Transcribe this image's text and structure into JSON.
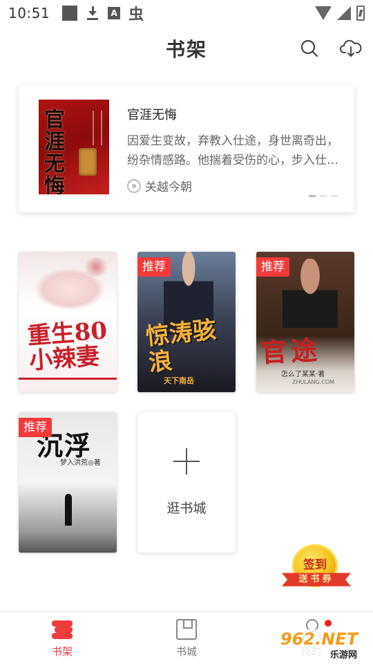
{
  "status_bar": {
    "time": "10:51",
    "icons_left": [
      "square-icon",
      "download-icon",
      "a-icon",
      "bug-icon"
    ],
    "icons_right": [
      "wifi-icon",
      "signal-icon",
      "battery-icon"
    ]
  },
  "header": {
    "title": "书架",
    "icons": [
      "search-icon",
      "cloud-download-icon"
    ]
  },
  "featured": {
    "title": "官涯无悔",
    "description": "因爱生变故，弃教入仕途，身世离奇出，纷杂情感路。他揣着受伤的心，步入仕…",
    "author": "关越今朝",
    "cover_text": "官涯无悔",
    "carousel": {
      "count": 3,
      "active_index": 0
    }
  },
  "books": [
    {
      "cover_text": "重生80小辣妻",
      "badge": ""
    },
    {
      "cover_text": "惊涛骇浪",
      "badge": "推荐",
      "publisher": "天下南岳"
    },
    {
      "cover_text": "官途",
      "badge": "推荐",
      "subline": "怎么了某某·著",
      "url": "ZHULANG.COM"
    },
    {
      "cover_text": "沉浮",
      "badge": "推荐",
      "author_line": "梦入洪荒◎著"
    }
  ],
  "add_book": {
    "label": "逛书城"
  },
  "signin": {
    "title": "签到",
    "ribbon": "送书券"
  },
  "bottom_nav": {
    "items": [
      {
        "label": "书架",
        "icon": "bookshelf-icon",
        "active": true
      },
      {
        "label": "书城",
        "icon": "bookstore-icon",
        "active": false
      },
      {
        "label": "我的",
        "icon": "profile-icon",
        "active": false
      }
    ]
  },
  "watermark": {
    "top": "962.NET",
    "bottom": "乐游网"
  },
  "colors": {
    "accent": "#f03c3c",
    "badge": "#f33a3a",
    "text_primary": "#222222",
    "text_secondary": "#666666"
  }
}
